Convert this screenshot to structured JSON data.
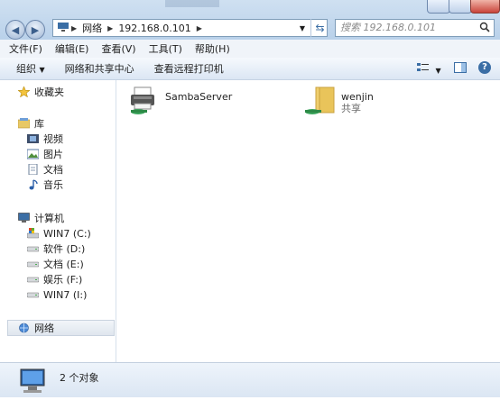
{
  "address": {
    "crumbs": [
      "网络",
      "192.168.0.101"
    ]
  },
  "search": {
    "placeholder": "搜索 192.168.0.101"
  },
  "menu": [
    "文件(F)",
    "编辑(E)",
    "查看(V)",
    "工具(T)",
    "帮助(H)"
  ],
  "commands": {
    "organize": "组织",
    "network_center": "网络和共享中心",
    "printers": "查看远程打印机"
  },
  "sidebar": {
    "favorites": "收藏夹",
    "libraries": "库",
    "library_items": [
      "视频",
      "图片",
      "文档",
      "音乐"
    ],
    "computer": "计算机",
    "drives": [
      "WIN7 (C:)",
      "软件 (D:)",
      "文档 (E:)",
      "娱乐 (F:)",
      "WIN7 (I:)"
    ],
    "network": "网络"
  },
  "items": [
    {
      "name": "SambaServer",
      "subtitle": ""
    },
    {
      "name": "wenjin",
      "subtitle": "共享"
    }
  ],
  "status": {
    "count": "2 个对象"
  },
  "colors": {
    "accent": "#3b6ea5",
    "folder": "#e9c45a"
  }
}
